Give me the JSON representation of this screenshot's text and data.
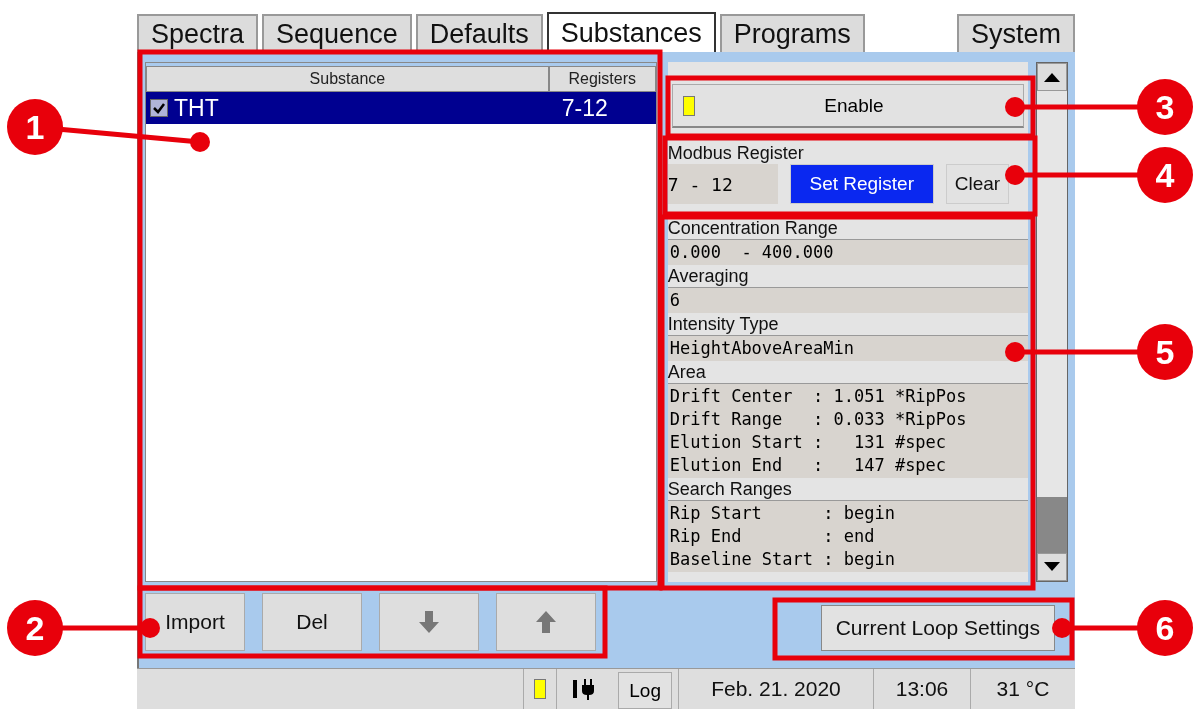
{
  "tabs": [
    {
      "label": "Spectra",
      "selected": false
    },
    {
      "label": "Sequence",
      "selected": false
    },
    {
      "label": "Defaults",
      "selected": false
    },
    {
      "label": "Substances",
      "selected": true
    },
    {
      "label": "Programs",
      "selected": false
    },
    {
      "label": "System",
      "selected": false
    }
  ],
  "substance_table": {
    "columns": [
      "Substance",
      "Registers"
    ],
    "rows": [
      {
        "name": "THT",
        "registers": "7-12",
        "checked": true,
        "selected": true
      }
    ]
  },
  "enable_button": {
    "label": "Enable"
  },
  "modbus_register": {
    "label": "Modbus Register",
    "value": "7 - 12",
    "buttons": [
      {
        "label": "Set Register",
        "highlighted": true
      },
      {
        "label": "Clear",
        "highlighted": false
      }
    ]
  },
  "sections": [
    {
      "label": "Concentration Range",
      "lines": [
        "0.000  - 400.000"
      ]
    },
    {
      "label": "Averaging",
      "lines": [
        "6"
      ]
    },
    {
      "label": "Intensity Type",
      "lines": [
        "HeightAboveAreaMin"
      ]
    },
    {
      "label": "Area",
      "lines": [
        "Drift Center  : 1.051 *RipPos",
        "Drift Range   : 0.033 *RipPos",
        "Elution Start :   131 #spec",
        "Elution End   :   147 #spec"
      ]
    },
    {
      "label": "Search Ranges",
      "lines": [
        "Rip Start      : begin",
        "Rip End        : end",
        "Baseline Start : begin"
      ]
    }
  ],
  "bottom_buttons": [
    {
      "kind": "text",
      "label": "Import"
    },
    {
      "kind": "text",
      "label": "Del"
    },
    {
      "kind": "arrow-down"
    },
    {
      "kind": "arrow-up"
    }
  ],
  "current_loop_button": "Current Loop Settings",
  "status_bar": {
    "log_button": "Log",
    "date": "Feb. 21. 2020",
    "time": "13:06",
    "temperature": "31 °C"
  },
  "annotations": [
    "1",
    "2",
    "3",
    "4",
    "5",
    "6"
  ]
}
